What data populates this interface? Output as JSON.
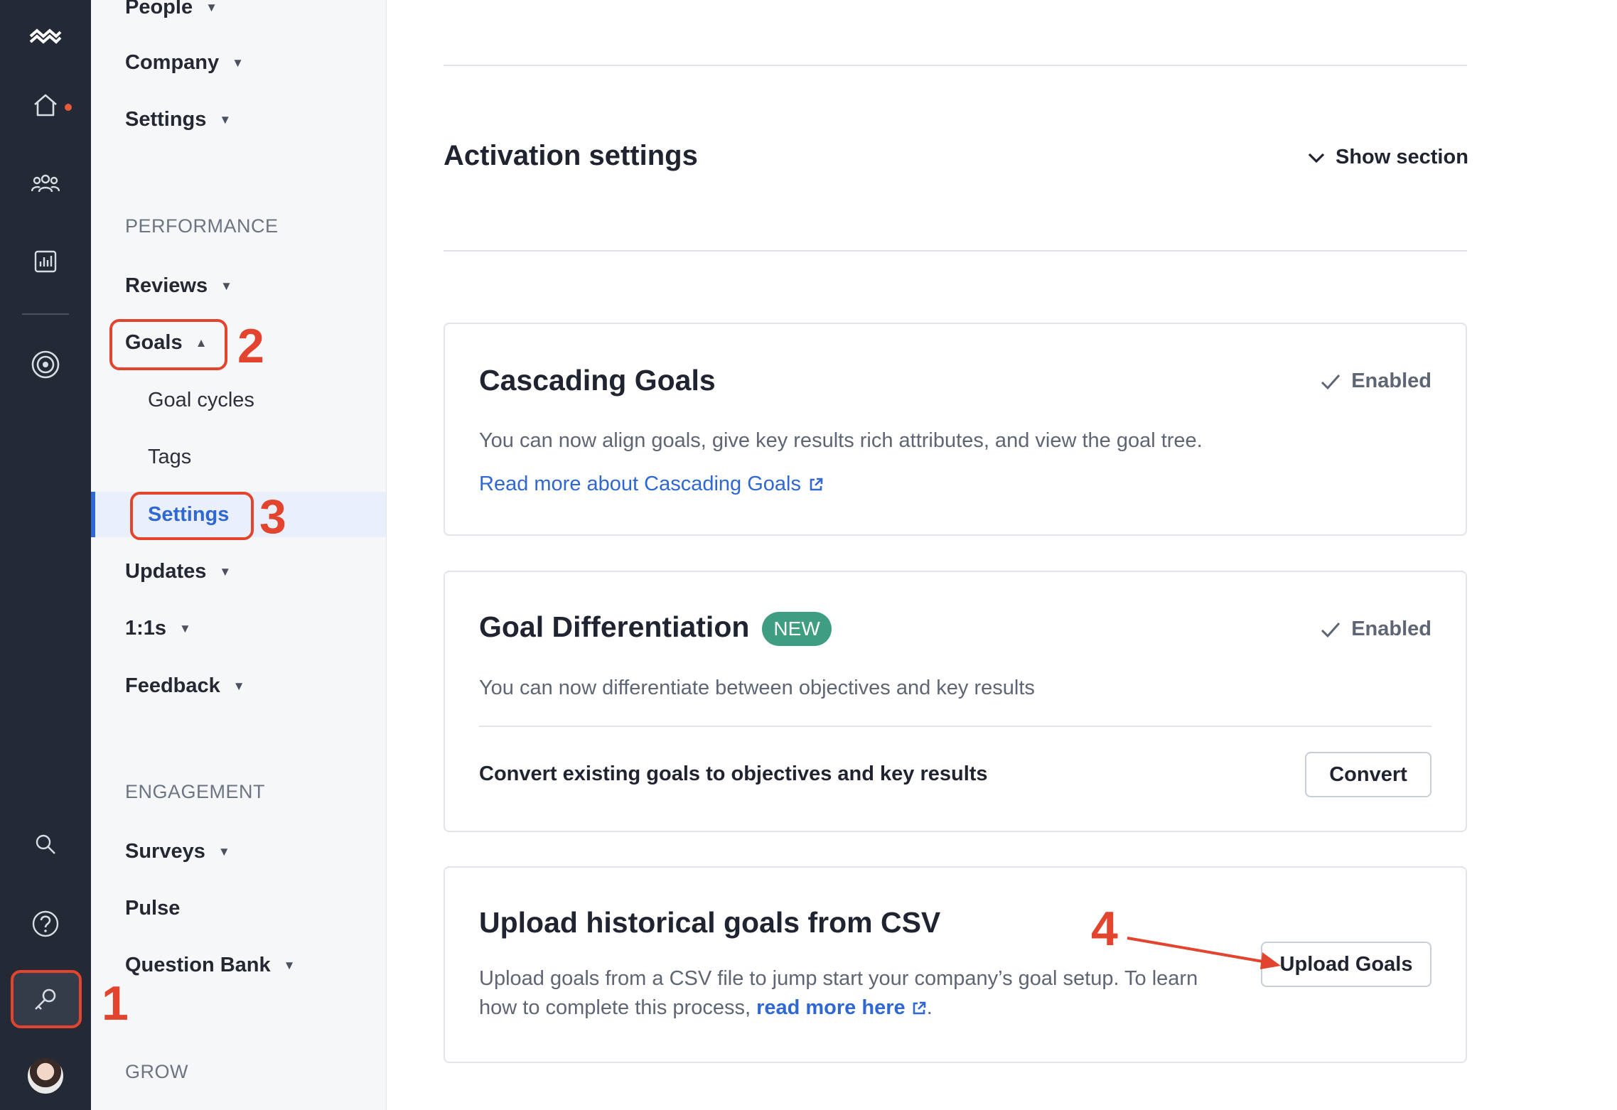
{
  "rail": {
    "icons": [
      "brand-logo-icon",
      "home-icon",
      "people-icon",
      "analytics-icon",
      "goals-target-icon",
      "search-icon",
      "help-icon",
      "admin-key-icon",
      "user-avatar"
    ],
    "accent_dot_color": "#e65a3a"
  },
  "sidebar": {
    "items_top": [
      {
        "label": "People"
      },
      {
        "label": "Company"
      },
      {
        "label": "Settings"
      }
    ],
    "performance_heading": "PERFORMANCE",
    "reviews": "Reviews",
    "goals": "Goals",
    "goals_sub": [
      "Goal cycles",
      "Tags",
      "Settings"
    ],
    "updates": "Updates",
    "one_on_ones": "1:1s",
    "feedback": "Feedback",
    "engagement_heading": "ENGAGEMENT",
    "surveys": "Surveys",
    "pulse": "Pulse",
    "question_bank": "Question Bank",
    "grow_heading": "GROW"
  },
  "main": {
    "section_title": "Activation settings",
    "show_section": "Show section",
    "cascading": {
      "title": "Cascading Goals",
      "status": "Enabled",
      "description": "You can now align goals, give key results rich attributes, and view the goal tree.",
      "link": "Read more about Cascading Goals"
    },
    "differentiation": {
      "title": "Goal Differentiation",
      "badge": "NEW",
      "status": "Enabled",
      "description": "You can now differentiate between objectives and key results",
      "convert_label": "Convert existing goals to objectives and key results",
      "convert_button": "Convert"
    },
    "upload": {
      "title": "Upload historical goals from CSV",
      "description_prefix": "Upload goals from a CSV file to jump start your company’s goal setup. To learn how to complete this process,",
      "link": "read more here",
      "description_suffix": ".",
      "button": "Upload Goals"
    }
  },
  "annotations": {
    "steps": [
      "1",
      "2",
      "3",
      "4"
    ],
    "color": "#e2442e"
  },
  "colors": {
    "rail_bg": "#242a35",
    "link_blue": "#2f67d3",
    "badge_green": "#3f9e82"
  }
}
